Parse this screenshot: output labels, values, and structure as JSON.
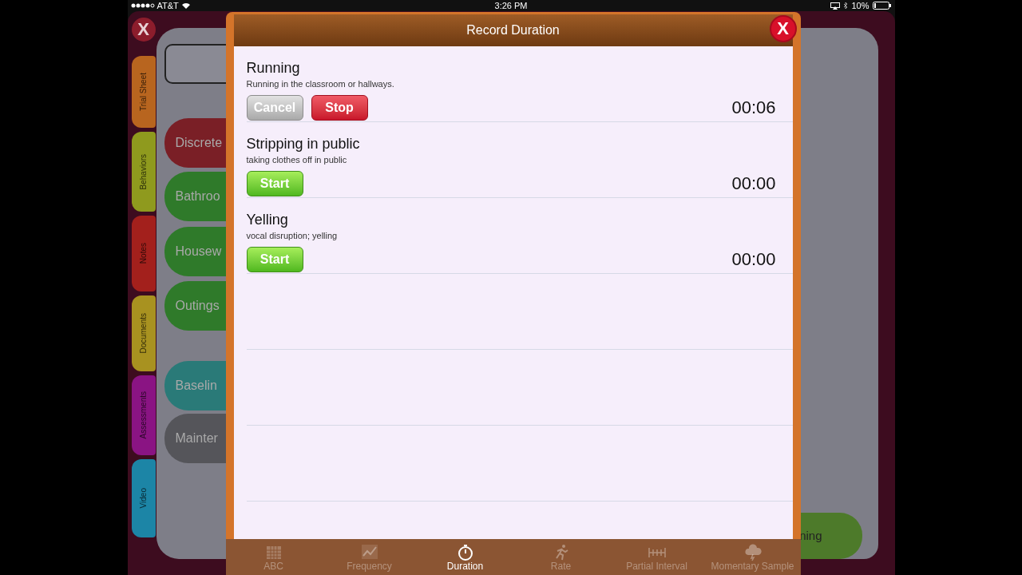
{
  "status_bar": {
    "carrier": "AT&T",
    "time": "3:26 PM",
    "battery": "10%"
  },
  "app": {
    "close_button": "X",
    "side_tabs": [
      {
        "label": "Trial Sheet",
        "color": "#b8651f"
      },
      {
        "label": "Behaviors",
        "color": "#8f9a1e"
      },
      {
        "label": "Notes",
        "color": "#a3201c"
      },
      {
        "label": "Documents",
        "color": "#a89220"
      },
      {
        "label": "Assessments",
        "color": "#8a1483"
      },
      {
        "label": "Video",
        "color": "#1c85a6"
      }
    ],
    "buttons": [
      {
        "label": "Discrete",
        "color": "#7a1f26"
      },
      {
        "label": "Bathroo",
        "color": "#2f7a2a"
      },
      {
        "label": "Housew",
        "color": "#2f7a2a"
      },
      {
        "label": "Outings",
        "color": "#2f7a2a"
      },
      {
        "label": "Baselin",
        "color": "#2a7a78"
      },
      {
        "label": "Mainter",
        "color": "#55555a"
      }
    ],
    "corner_button": "ning"
  },
  "modal": {
    "title": "Record Duration",
    "close_button": "X",
    "behaviors": [
      {
        "name": "Running",
        "description": "Running in the classroom or hallways.",
        "buttons": [
          {
            "label": "Cancel",
            "kind": "cancel"
          },
          {
            "label": "Stop",
            "kind": "stop"
          }
        ],
        "timer": "00:06"
      },
      {
        "name": "Stripping in public",
        "description": "taking clothes off in public",
        "buttons": [
          {
            "label": "Start",
            "kind": "start"
          }
        ],
        "timer": "00:00"
      },
      {
        "name": "Yelling",
        "description": "vocal disruption; yelling",
        "buttons": [
          {
            "label": "Start",
            "kind": "start"
          }
        ],
        "timer": "00:00"
      }
    ],
    "tab_bar": [
      {
        "label": "ABC",
        "selected": false
      },
      {
        "label": "Frequency",
        "selected": false
      },
      {
        "label": "Duration",
        "selected": true
      },
      {
        "label": "Rate",
        "selected": false
      },
      {
        "label": "Partial Interval",
        "selected": false
      },
      {
        "label": "Momentary Sample",
        "selected": false
      }
    ]
  }
}
